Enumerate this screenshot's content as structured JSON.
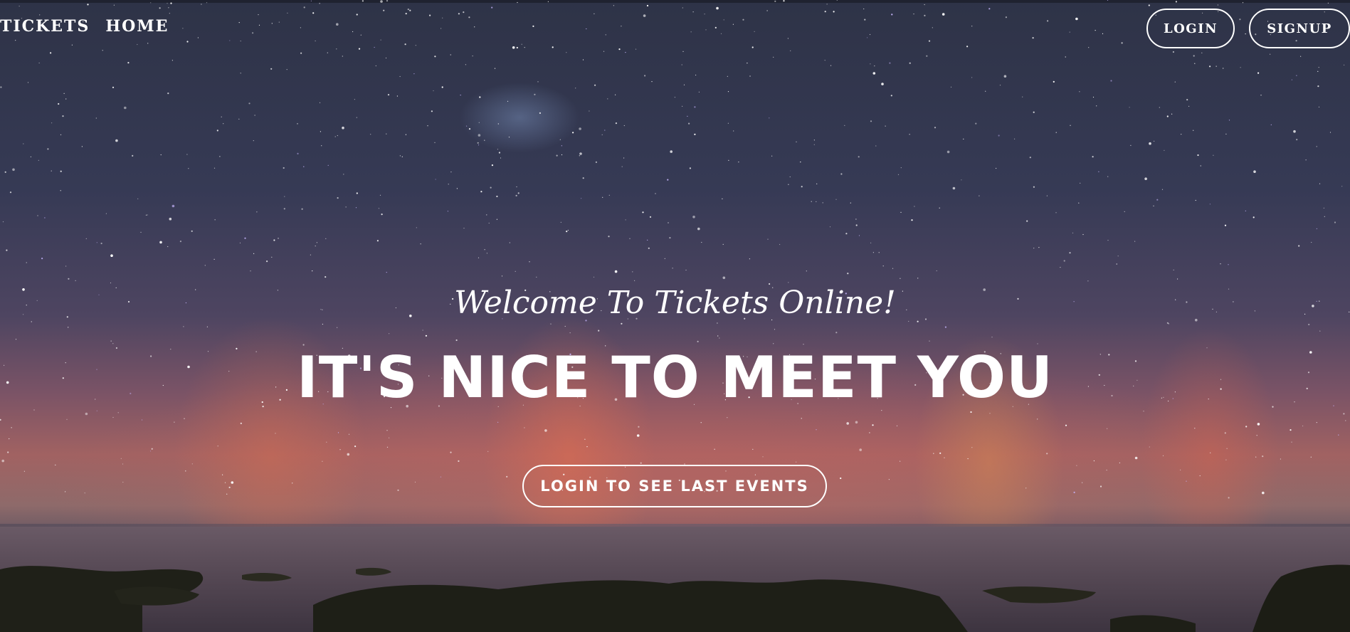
{
  "nav": {
    "brand": "TICKETS",
    "home": "HOME",
    "login": "LOGIN",
    "signup": "SIGNUP"
  },
  "hero": {
    "welcome": "Welcome To Tickets Online!",
    "headline": "IT'S NICE TO MEET YOU",
    "cta": "LOGIN TO SEE LAST EVENTS",
    "background": "night sky with stars and aurora over sea and rocks"
  },
  "colors": {
    "text": "#ffffff",
    "sky_top": "#2e3347",
    "aurora": "#a16262"
  }
}
